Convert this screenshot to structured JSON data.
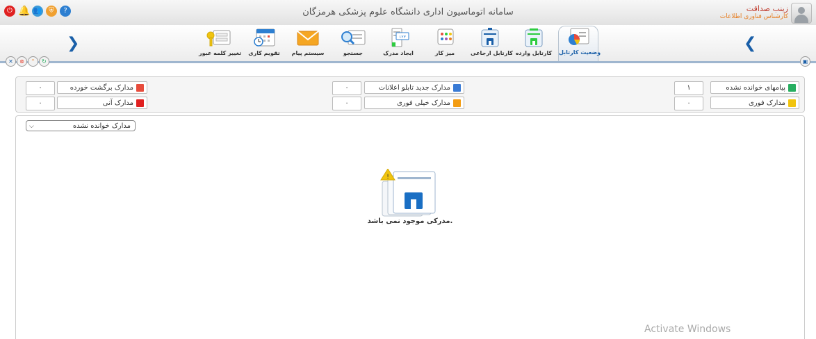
{
  "header": {
    "title": "سامانه اتوماسیون اداری دانشگاه علوم پزشکی هرمزگان",
    "user_name": "زینب صداقت",
    "user_role": "کارشناس فناوری اطلاعات"
  },
  "top_icons": [
    "power-icon",
    "bell-icon",
    "users-icon",
    "shield-icon",
    "help-icon"
  ],
  "toolbar": {
    "items": [
      {
        "label": "وضعیت کارتابل",
        "icon": "pie-chart-icon",
        "active": true
      },
      {
        "label": "کارتابل وارده",
        "icon": "inbox-icon"
      },
      {
        "label": "کارتابل ارجاعی",
        "icon": "tray-icon"
      },
      {
        "label": "میز کار",
        "icon": "desk-icon"
      },
      {
        "label": "ایجاد مدرک",
        "icon": "new-document-icon"
      },
      {
        "label": "جستجو",
        "icon": "search-icon"
      },
      {
        "label": "سیستم پیام",
        "icon": "envelope-icon"
      },
      {
        "label": "تقویم کاری",
        "icon": "calendar-icon"
      },
      {
        "label": "تغییر کلمه عبور",
        "icon": "password-key-icon"
      }
    ]
  },
  "stats": [
    {
      "label": "پیامهای خوانده نشده",
      "count": "۱",
      "icon": "message-icon",
      "color": "#27ae60"
    },
    {
      "label": "مدارک جدید تابلو اعلانات",
      "count": "۰",
      "icon": "notice-board-icon",
      "color": "#3a7bd5"
    },
    {
      "label": "مدارک برگشت خورده",
      "count": "۰",
      "icon": "returned-document-icon",
      "color": "#e74c3c"
    },
    {
      "label": "مدارک فوری",
      "count": "۰",
      "icon": "urgent-document-icon",
      "color": "#f1c40f"
    },
    {
      "label": "مدارک خیلی فوری",
      "count": "۰",
      "icon": "very-urgent-document-icon",
      "color": "#f39c12"
    },
    {
      "label": "مدارک آنی",
      "count": "۰",
      "icon": "immediate-document-icon",
      "color": "#e02020"
    }
  ],
  "filter": {
    "selected": "مدارک خوانده نشده"
  },
  "empty_message": "مدرکی موجود نمی باشد.",
  "watermark": "Activate Windows"
}
